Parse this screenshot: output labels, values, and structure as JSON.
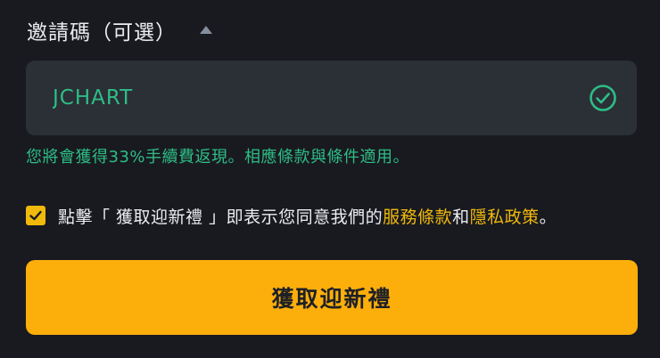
{
  "referral": {
    "title": "邀請碼（可選）",
    "code_value": "JCHART",
    "rebate_note": "您將會獲得33%手續費返現。相應條款與條件適用。"
  },
  "terms": {
    "checked": true,
    "prefix": "點擊「 獲取迎新禮 」即表示您同意我們的",
    "terms_link": "服務條款",
    "joiner": "和",
    "privacy_link": "隱私政策",
    "suffix": "。"
  },
  "submit": {
    "label": "獲取迎新禮"
  },
  "colors": {
    "background": "#181a20",
    "input_bg": "#2b2f36",
    "success_green": "#2ebd85",
    "accent_yellow": "#f0b90b",
    "button_yellow": "#fcae0b"
  },
  "icons": {
    "collapse": "caret-up-icon",
    "valid": "check-circle-icon",
    "checkbox": "checkmark-icon"
  }
}
